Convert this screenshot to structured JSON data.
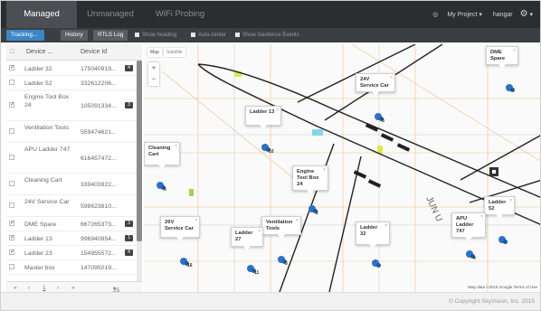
{
  "nav": {
    "tabs": [
      "Managed",
      "Unmanaged",
      "WiFi Probing"
    ],
    "active_tab": "Managed",
    "project_label": "My Project",
    "user_label": "hangar"
  },
  "toolbar": {
    "tracking_label": "Tracking...",
    "history_label": "History",
    "rtls_label": "RTLS Log",
    "show_heading_label": "Show heading",
    "auto_center_label": "Auto-center",
    "show_geofence_label": "Show Geofence Events"
  },
  "table": {
    "col_device": "Device ...",
    "col_id": "Device Id",
    "rows": [
      {
        "name": "Ladder 32",
        "id": "175040919...",
        "checked": true,
        "badge": "4"
      },
      {
        "name": "Ladder 52",
        "id": "332612206...",
        "checked": false,
        "badge": ""
      },
      {
        "name": "Engine Tool Box 24",
        "id": "105091334...",
        "checked": true,
        "badge": "3"
      },
      {
        "name": "Ventilation Tools",
        "id": "559474621...",
        "checked": false,
        "badge": ""
      },
      {
        "name": "APU Ladder 747",
        "id": "616457472...",
        "checked": false,
        "badge": ""
      },
      {
        "name": "Cleaning Cart",
        "id": "339403922...",
        "checked": false,
        "badge": ""
      },
      {
        "name": "24V Service Car",
        "id": "598623810...",
        "checked": false,
        "badge": ""
      },
      {
        "name": "DME Spare",
        "id": "667265373...",
        "checked": true,
        "badge": "3"
      },
      {
        "name": "Ladder 13",
        "id": "996940854...",
        "checked": true,
        "badge": "1"
      },
      {
        "name": "Ladder 23",
        "id": "154955572...",
        "checked": true,
        "badge": "4"
      },
      {
        "name": "Master box",
        "id": "147095019...",
        "checked": false,
        "badge": ""
      }
    ]
  },
  "pager": {
    "first": "«",
    "prev": "‹",
    "page": "1",
    "next": "›",
    "last": "»",
    "page_size": "25"
  },
  "map": {
    "map_type": "Map",
    "satellite_type": "Satellite",
    "zoom_in": "+",
    "zoom_out": "−",
    "attribution": "Map data ©2015 Google   Terms of Use",
    "markers": [
      {
        "label": "DME Spare",
        "num": ""
      },
      {
        "label": "24V Service Car",
        "num": "8"
      },
      {
        "label": "Ladder 13",
        "num": "10"
      },
      {
        "label": "Cleaning Cart",
        "num": "0"
      },
      {
        "label": "Engine Tool Box 24",
        "num": "2"
      },
      {
        "label": "Ladder 52",
        "num": ""
      },
      {
        "label": "APU Ladder 747",
        "num": "4"
      },
      {
        "label": "26V Service Car",
        "num": "16"
      },
      {
        "label": "Ventilation Tools",
        "num": "5"
      },
      {
        "label": "Ladder 27",
        "num": "11"
      },
      {
        "label": "Ladder 32",
        "num": ""
      }
    ]
  },
  "footer": {
    "copyright": "© Copyright SkyVision, Inc. 2015"
  },
  "colors": {
    "nav_bg": "#2b2d30",
    "tracking_btn": "#3d86c6",
    "pin": "#2e72c2"
  }
}
